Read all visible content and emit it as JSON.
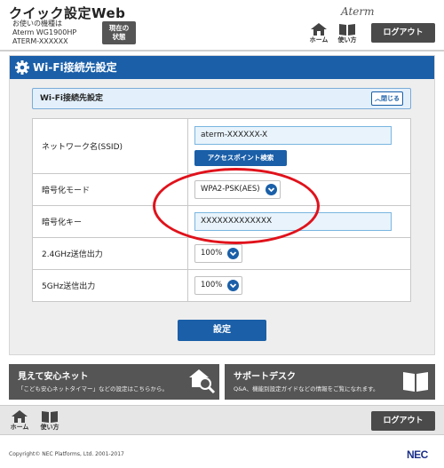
{
  "header": {
    "app_title": "クイック設定Web",
    "device_line1": "お使いの機種は",
    "device_line2": "Aterm WG1900HP",
    "device_line3": "ATERM-XXXXXX",
    "status_line1": "現在の",
    "status_line2": "状態",
    "logo": "Aterm",
    "home_label": "ホーム",
    "help_label": "使い方",
    "logout_label": "ログアウト"
  },
  "main": {
    "title": "Wi-Fi接続先設定",
    "section_title": "Wi-Fi接続先設定",
    "close_label": "閉じる",
    "rows": {
      "ssid_label": "ネットワーク名(SSID)",
      "ssid_value": "aterm-XXXXXX-X",
      "ap_search_label": "アクセスポイント検索",
      "encryption_mode_label": "暗号化モード",
      "encryption_mode_value": "WPA2-PSK(AES)",
      "encryption_key_label": "暗号化キー",
      "encryption_key_value": "XXXXXXXXXXXXX",
      "tx_24_label": "2.4GHz送信出力",
      "tx_24_value": "100%",
      "tx_5_label": "5GHz送信出力",
      "tx_5_value": "100%"
    },
    "submit_label": "設定"
  },
  "banners": {
    "left_title": "見えて安心ネット",
    "left_desc": "「こども安心ネットタイマー」などの設定はこちらから。",
    "right_title": "サポートデスク",
    "right_desc": "Q&A、機能別設定ガイドなどの情報をご覧になれます。"
  },
  "footer": {
    "home_label": "ホーム",
    "help_label": "使い方",
    "logout_label": "ログアウト",
    "copyright": "Copyright© NEC Platforms, Ltd. 2001-2017",
    "brand": "NEC"
  },
  "colors": {
    "accent": "#1a5fa8",
    "highlight": "#e0121b",
    "dark_button": "#4a4a4a"
  }
}
